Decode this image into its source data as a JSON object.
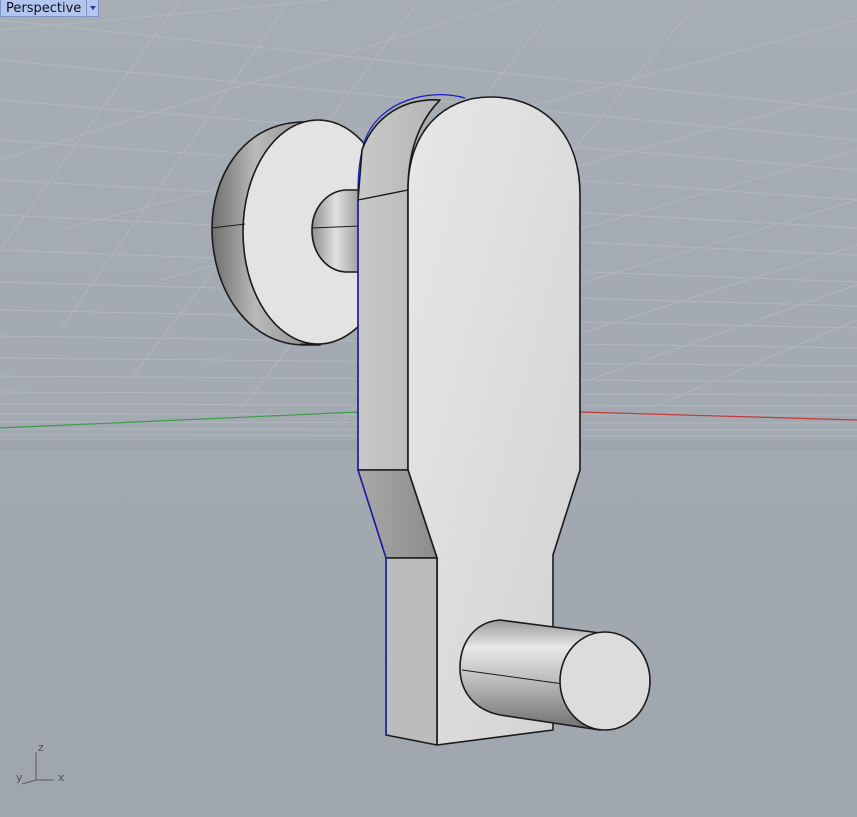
{
  "viewport": {
    "name": "Perspective",
    "background_color": "#a2a8b0",
    "grid_color": "#b4b9c0",
    "x_axis_color": "#c33c3c",
    "y_axis_color": "#3e9a4a",
    "selection_color": "#1a1acd"
  },
  "menu_icon": "chevron-down-icon",
  "axis_widget": {
    "z": "z",
    "y": "y",
    "x": "x"
  }
}
